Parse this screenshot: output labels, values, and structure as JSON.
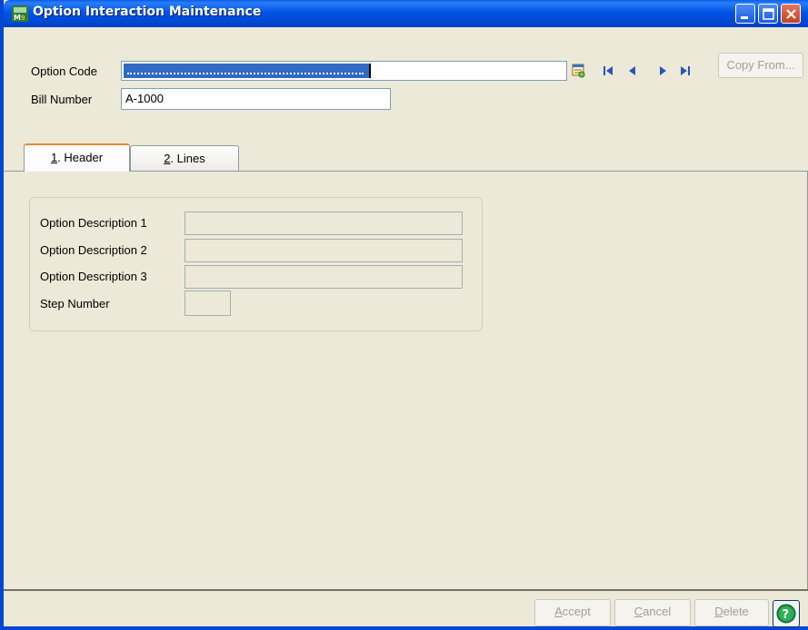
{
  "window": {
    "title": "Option Interaction Maintenance",
    "app_icon": "mas90-icon"
  },
  "fields": {
    "option_code_label": "Option Code",
    "bill_number_label": "Bill Number",
    "bill_number_value": "A-1000"
  },
  "toolbar": {
    "copy_from_label": "Copy From..."
  },
  "tabs": [
    {
      "hotkey": "1",
      "label": ". Header"
    },
    {
      "hotkey": "2",
      "label": ". Lines"
    }
  ],
  "header_tab": {
    "option_description_1_label": "Option Description 1",
    "option_description_2_label": "Option Description 2",
    "option_description_3_label": "Option Description 3",
    "step_number_label": "Step Number"
  },
  "buttons": {
    "accept_hotkey": "A",
    "accept_rest": "ccept",
    "cancel_hotkey": "C",
    "cancel_rest": "ancel",
    "delete_hotkey": "D",
    "delete_rest": "elete"
  },
  "colors": {
    "titlebar": "#0055e5",
    "selection": "#316ac5",
    "window_bg": "#ece9d8"
  }
}
